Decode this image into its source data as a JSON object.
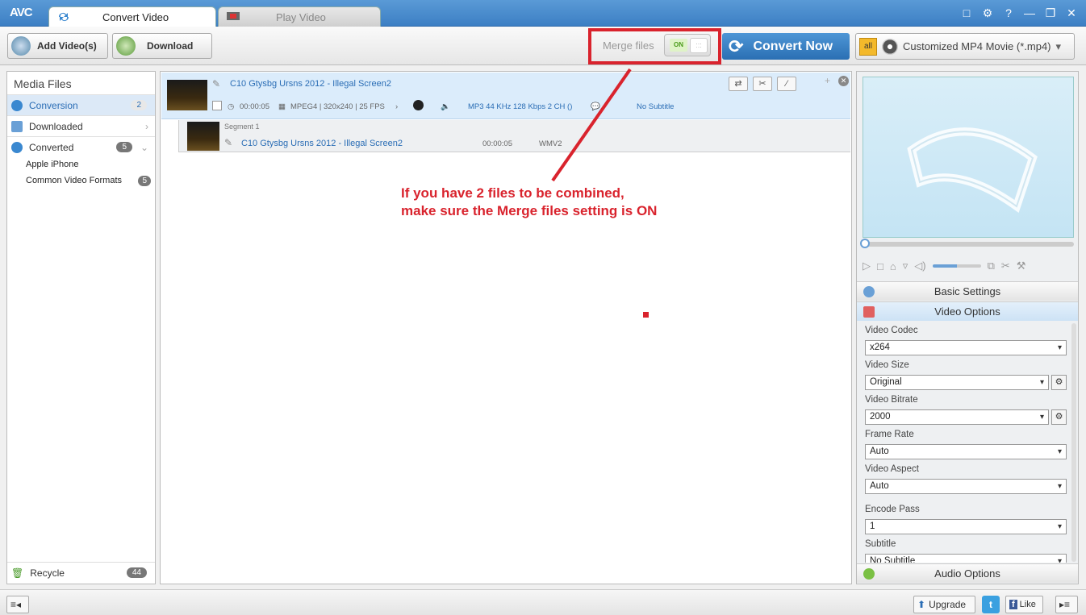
{
  "app": {
    "logo": "AVC"
  },
  "tabs": [
    {
      "label": "Convert Video",
      "icon": "convert-icon"
    },
    {
      "label": "Play Video",
      "icon": "film-icon"
    }
  ],
  "window_controls": [
    "□",
    "⚙",
    "?",
    "—",
    "❐",
    "✕"
  ],
  "toolbar": {
    "add_label": "Add Video(s)",
    "download_label": "Download",
    "merge_label": "Merge files",
    "merge_state": "ON",
    "convert_label": "Convert Now",
    "profile_all": "all",
    "profile_label": "Customized MP4 Movie (*.mp4)"
  },
  "sidebar": {
    "title": "Media Files",
    "conversion": {
      "label": "Conversion",
      "count": "2"
    },
    "downloaded": {
      "label": "Downloaded"
    },
    "converted": {
      "label": "Converted",
      "count": "5"
    },
    "sub": [
      {
        "label": "Apple iPhone"
      },
      {
        "label": "Common Video Formats",
        "count": "5"
      }
    ],
    "recycle": {
      "label": "Recycle",
      "count": "44"
    }
  },
  "file": {
    "name": "C10 Gtysbg Ursns 2012 - Illegal Screen2",
    "duration": "00:00:05",
    "video_info": "MPEG4 | 320x240 | 25 FPS",
    "audio_info": "MP3 44 KHz 128 Kbps 2 CH ()",
    "subtitle": "No Subtitle",
    "segment": {
      "label": "Segment 1",
      "name": "C10 Gtysbg Ursns 2012 - Illegal Screen2",
      "duration": "00:00:05",
      "format": "WMV2"
    }
  },
  "annotation": {
    "line1": "If you have 2 files to be combined,",
    "line2": "make sure the Merge files setting is ON",
    "color": "#d9232d"
  },
  "settings": {
    "basic": "Basic Settings",
    "video": "Video Options",
    "audio": "Audio Options",
    "fields": {
      "codec": {
        "label": "Video Codec",
        "value": "x264"
      },
      "size": {
        "label": "Video Size",
        "value": "Original"
      },
      "bitrate": {
        "label": "Video Bitrate",
        "value": "2000"
      },
      "frame_rate": {
        "label": "Frame Rate",
        "value": "Auto"
      },
      "aspect": {
        "label": "Video Aspect",
        "value": "Auto"
      },
      "encode_pass": {
        "label": "Encode Pass",
        "value": "1"
      },
      "subtitle": {
        "label": "Subtitle",
        "value": "No Subtitle"
      }
    }
  },
  "statusbar": {
    "upgrade": "Upgrade",
    "like": "Like",
    "twitter": "t",
    "facebook": "f"
  }
}
